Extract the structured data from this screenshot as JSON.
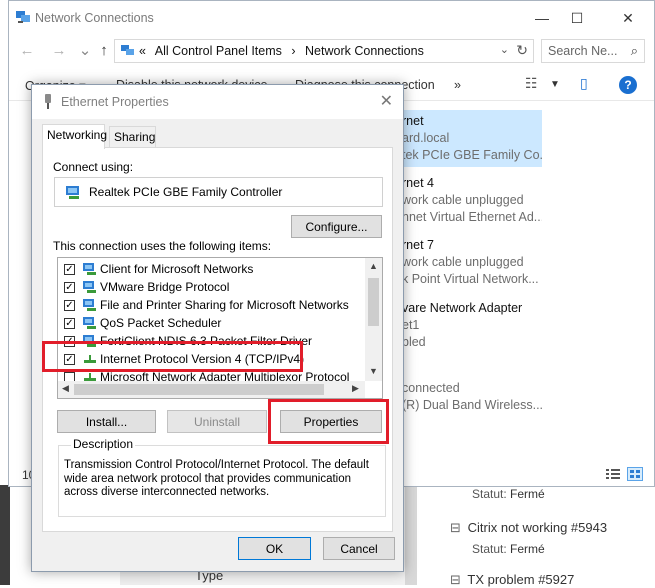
{
  "background_page": {
    "tickets": [
      {
        "id_title": "Citrix not working #5943",
        "status_label": "Statut:",
        "status_value": "Fermé"
      },
      {
        "id_title": "TX problem #5927"
      }
    ],
    "first_status": {
      "status_label": "Statut:",
      "status_value": "Fermé"
    },
    "type_label": "Type"
  },
  "network_connections": {
    "title": "Network Connections",
    "breadcrumb": [
      "«",
      "All Control Panel Items",
      "›",
      "Network Connections"
    ],
    "search_placeholder": "Search Ne...",
    "commands": {
      "organize": "Organize ▾",
      "disable": "Disable this network device",
      "diagnose": "Diagnose this connection",
      "more": "»"
    },
    "adapters": [
      {
        "name": "rnet",
        "lines": [
          "ard.local",
          "tek PCIe GBE Family Co..."
        ],
        "selected": true
      },
      {
        "name": "rnet 4",
        "lines": [
          "work cable unplugged",
          "nnet Virtual Ethernet Ad..."
        ]
      },
      {
        "name": "rnet 7",
        "lines": [
          "work cable unplugged",
          "k Point Virtual Network..."
        ]
      },
      {
        "name": "vare Network Adapter",
        "lines": [
          "et1",
          "bled"
        ]
      },
      {
        "name": "i",
        "lines": [
          "connected",
          "(R) Dual Band Wireless..."
        ]
      }
    ],
    "item_count": "10"
  },
  "dialog": {
    "title": "Ethernet Properties",
    "tabs": [
      "Networking",
      "Sharing"
    ],
    "connect_using_label": "Connect using:",
    "device_name": "Realtek PCIe GBE Family Controller",
    "configure_button": "Configure...",
    "items_label": "This connection uses the following items:",
    "items": [
      {
        "label": "Client for Microsoft Networks",
        "checked": true
      },
      {
        "label": "VMware Bridge Protocol",
        "checked": true
      },
      {
        "label": "File and Printer Sharing for Microsoft Networks",
        "checked": true
      },
      {
        "label": "QoS Packet Scheduler",
        "checked": true
      },
      {
        "label": "FortiClient NDIS 6.3 Packet Filter Driver",
        "checked": true
      },
      {
        "label": "Internet Protocol Version 4 (TCP/IPv4)",
        "checked": true
      },
      {
        "label": "Microsoft Network Adapter Multiplexor Protocol",
        "checked": false
      }
    ],
    "install_button": "Install...",
    "uninstall_button": "Uninstall",
    "properties_button": "Properties",
    "description_legend": "Description",
    "description_text": "Transmission Control Protocol/Internet Protocol. The default wide area network protocol that provides communication across diverse interconnected networks.",
    "ok_button": "OK",
    "cancel_button": "Cancel"
  },
  "highlight_color": "#e11d2a"
}
